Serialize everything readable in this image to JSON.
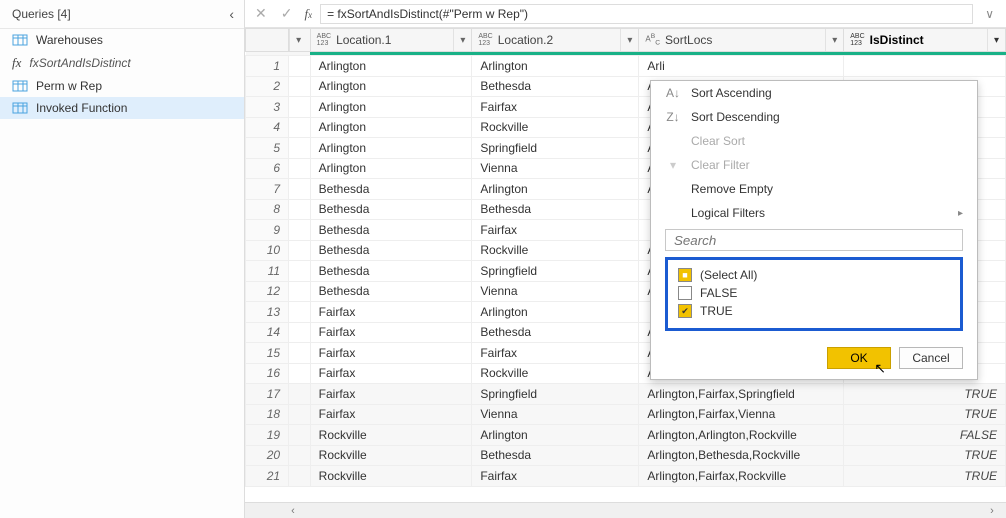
{
  "sidebar": {
    "title": "Queries [4]",
    "items": [
      {
        "label": "Warehouses",
        "icon": "table"
      },
      {
        "label": "fxSortAndIsDistinct",
        "icon": "fx"
      },
      {
        "label": "Perm w Rep",
        "icon": "table"
      },
      {
        "label": "Invoked Function",
        "icon": "table",
        "selected": true
      }
    ]
  },
  "formula_bar": {
    "value": "= fxSortAndIsDistinct(#\"Perm w Rep\")"
  },
  "columns": {
    "loc1": "Location.1",
    "loc2": "Location.2",
    "sortlocs": "SortLocs",
    "isdistinct": "IsDistinct",
    "type_abc123": "ABC\n123",
    "type_abc": "ABC"
  },
  "rows": [
    {
      "n": 1,
      "l1": "Arlington",
      "l2": "Arlington",
      "s": "Arli",
      "d": ""
    },
    {
      "n": 2,
      "l1": "Arlington",
      "l2": "Bethesda",
      "s": "Arli",
      "d": ""
    },
    {
      "n": 3,
      "l1": "Arlington",
      "l2": "Fairfax",
      "s": "Arli",
      "d": ""
    },
    {
      "n": 4,
      "l1": "Arlington",
      "l2": "Rockville",
      "s": "Arli",
      "d": ""
    },
    {
      "n": 5,
      "l1": "Arlington",
      "l2": "Springfield",
      "s": "Arli",
      "d": ""
    },
    {
      "n": 6,
      "l1": "Arlington",
      "l2": "Vienna",
      "s": "Arli",
      "d": ""
    },
    {
      "n": 7,
      "l1": "Bethesda",
      "l2": "Arlington",
      "s": "Arli",
      "d": ""
    },
    {
      "n": 8,
      "l1": "Bethesda",
      "l2": "Bethesda",
      "s": "",
      "d": ""
    },
    {
      "n": 9,
      "l1": "Bethesda",
      "l2": "Fairfax",
      "s": "",
      "d": ""
    },
    {
      "n": 10,
      "l1": "Bethesda",
      "l2": "Rockville",
      "s": "Arli",
      "d": ""
    },
    {
      "n": 11,
      "l1": "Bethesda",
      "l2": "Springfield",
      "s": "Arli",
      "d": ""
    },
    {
      "n": 12,
      "l1": "Bethesda",
      "l2": "Vienna",
      "s": "Arli",
      "d": ""
    },
    {
      "n": 13,
      "l1": "Fairfax",
      "l2": "Arlington",
      "s": "",
      "d": ""
    },
    {
      "n": 14,
      "l1": "Fairfax",
      "l2": "Bethesda",
      "s": "Arli",
      "d": ""
    },
    {
      "n": 15,
      "l1": "Fairfax",
      "l2": "Fairfax",
      "s": "Arli",
      "d": ""
    },
    {
      "n": 16,
      "l1": "Fairfax",
      "l2": "Rockville",
      "s": "Arlington,Fairfax,Rockville",
      "d": ""
    },
    {
      "n": 17,
      "l1": "Fairfax",
      "l2": "Springfield",
      "s": "Arlington,Fairfax,Springfield",
      "d": "TRUE"
    },
    {
      "n": 18,
      "l1": "Fairfax",
      "l2": "Vienna",
      "s": "Arlington,Fairfax,Vienna",
      "d": "TRUE"
    },
    {
      "n": 19,
      "l1": "Rockville",
      "l2": "Arlington",
      "s": "Arlington,Arlington,Rockville",
      "d": "FALSE"
    },
    {
      "n": 20,
      "l1": "Rockville",
      "l2": "Bethesda",
      "s": "Arlington,Bethesda,Rockville",
      "d": "TRUE"
    },
    {
      "n": 21,
      "l1": "Rockville",
      "l2": "Fairfax",
      "s": "Arlington,Fairfax,Rockville",
      "d": "TRUE"
    }
  ],
  "popup": {
    "sort_asc": "Sort Ascending",
    "sort_desc": "Sort Descending",
    "clear_sort": "Clear Sort",
    "clear_filter": "Clear Filter",
    "remove_empty": "Remove Empty",
    "logical": "Logical Filters",
    "search_placeholder": "Search",
    "opt_all": "(Select All)",
    "opt_false": "FALSE",
    "opt_true": "TRUE",
    "ok": "OK",
    "cancel": "Cancel"
  }
}
